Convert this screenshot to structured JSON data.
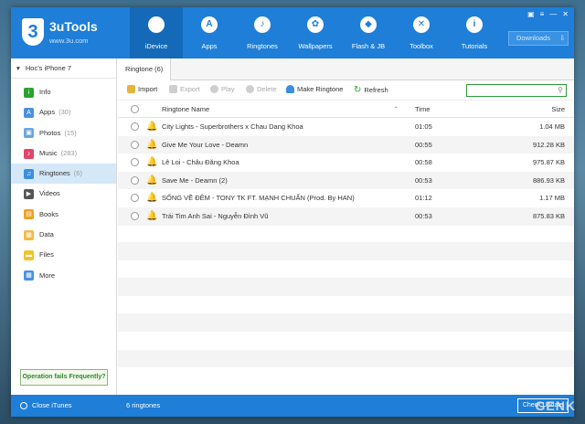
{
  "app": {
    "title": "3uTools",
    "url": "www.3u.com",
    "logo_mark": "3"
  },
  "nav": [
    {
      "label": "iDevice",
      "icon": "apple-icon",
      "glyph": ""
    },
    {
      "label": "Apps",
      "icon": "apps-icon",
      "glyph": "A"
    },
    {
      "label": "Ringtones",
      "icon": "bell-icon",
      "glyph": "♪"
    },
    {
      "label": "Wallpapers",
      "icon": "wallpaper-icon",
      "glyph": "✿"
    },
    {
      "label": "Flash & JB",
      "icon": "dropbox-icon",
      "glyph": "◆"
    },
    {
      "label": "Toolbox",
      "icon": "tools-icon",
      "glyph": "✕"
    },
    {
      "label": "Tutorials",
      "icon": "info-icon",
      "glyph": "i"
    }
  ],
  "window_controls": [
    "▣",
    "≡",
    "—",
    "✕"
  ],
  "downloads_label": "Downloads",
  "device_name": "Hoc's iPhone 7",
  "sidebar": [
    {
      "label": "Info",
      "count": "",
      "color": "#2ba12f",
      "glyph": "i"
    },
    {
      "label": "Apps",
      "count": "(30)",
      "color": "#4a90e2",
      "glyph": "A"
    },
    {
      "label": "Photos",
      "count": "(15)",
      "color": "#6aa6dc",
      "glyph": "▣"
    },
    {
      "label": "Music",
      "count": "(283)",
      "color": "#e2456a",
      "glyph": "♪"
    },
    {
      "label": "Ringtones",
      "count": "(6)",
      "color": "#3a8ee0",
      "glyph": "♫"
    },
    {
      "label": "Videos",
      "count": "",
      "color": "#555555",
      "glyph": "▶"
    },
    {
      "label": "Books",
      "count": "",
      "color": "#f0a020",
      "glyph": "▤"
    },
    {
      "label": "Data",
      "count": "",
      "color": "#f5b942",
      "glyph": "▦"
    },
    {
      "label": "Files",
      "count": "",
      "color": "#f2c230",
      "glyph": "▬"
    },
    {
      "label": "More",
      "count": "",
      "color": "#4a90e2",
      "glyph": "▦"
    }
  ],
  "operation_fails": "Operation fails Frequently?",
  "tab_label": "Ringtone (6)",
  "toolbar": {
    "import": "Import",
    "export": "Export",
    "play": "Play",
    "delete": "Delete",
    "make_ringtone": "Make Ringtone",
    "refresh": "Refresh"
  },
  "table": {
    "headers": {
      "name": "Ringtone Name",
      "time": "Time",
      "size": "Size"
    },
    "rows": [
      {
        "name": "City Lights - Superbrothers x Chau Dang Khoa",
        "time": "01:05",
        "size": "1.04 MB"
      },
      {
        "name": "Give Me Your Love - Deamn",
        "time": "00:55",
        "size": "912.28 KB"
      },
      {
        "name": "Lê Loi - Châu Đăng Khoa",
        "time": "00:58",
        "size": "975.87 KB"
      },
      {
        "name": "Save Me - Deamn (2)",
        "time": "00:53",
        "size": "886.93 KB"
      },
      {
        "name": "SỐNG VỀ ĐÊM - TONY TK FT. MẠNH CHUẨN (Prod. By HAN)",
        "time": "01:12",
        "size": "1.17 MB"
      },
      {
        "name": "Trái Tim Anh Sai - Nguyễn Đình Vũ",
        "time": "00:53",
        "size": "875.83 KB"
      }
    ]
  },
  "bottom": {
    "close_itunes": "Close iTunes",
    "count": "6 ringtones",
    "check_update": "Check Update"
  },
  "watermark": "GENK"
}
